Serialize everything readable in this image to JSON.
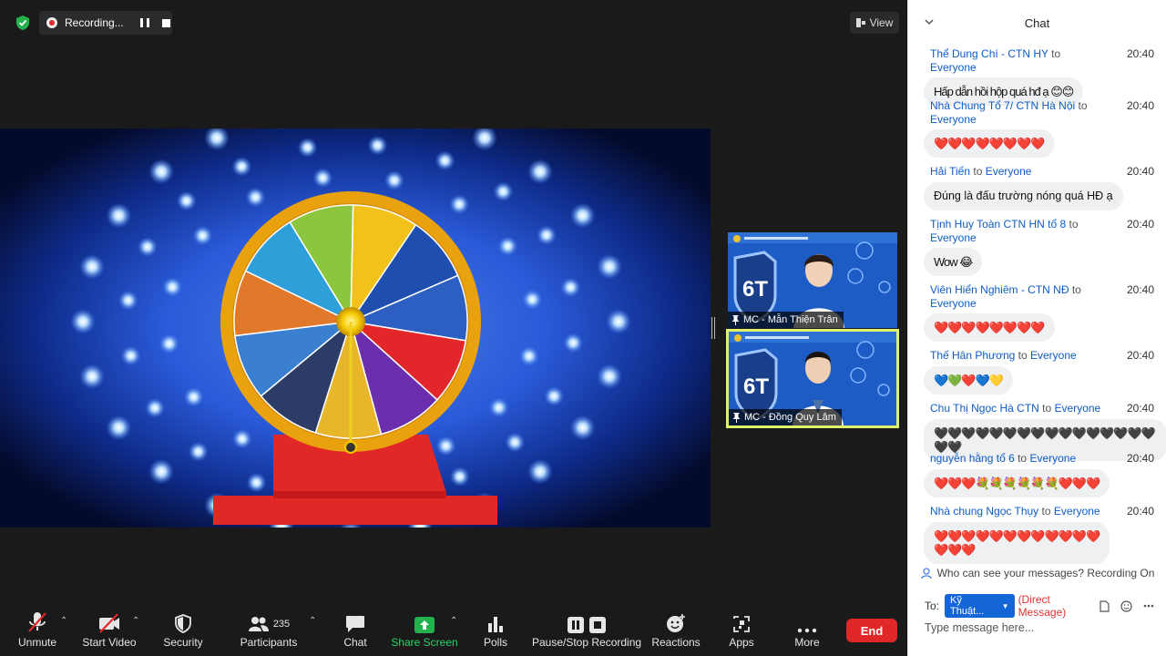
{
  "recording": {
    "label": "Recording..."
  },
  "view_button": {
    "label": "View"
  },
  "participants_tiles": [
    {
      "name": "MC - Mẫn Thiện Trân"
    },
    {
      "name": "MC - Đồng Quy Lâm"
    }
  ],
  "toolbar": {
    "unmute": "Unmute",
    "start_video": "Start Video",
    "security": "Security",
    "participants": "Participants",
    "participants_count": "235",
    "chat": "Chat",
    "share_screen": "Share Screen",
    "polls": "Polls",
    "pause_stop_recording": "Pause/Stop Recording",
    "reactions": "Reactions",
    "apps": "Apps",
    "more": "More",
    "end": "End"
  },
  "chat": {
    "title": "Chat",
    "messages": [
      {
        "sender": "Thể Dung Chí - CTN HY",
        "to_word": "to",
        "recipient": "Everyone",
        "time": "20:40",
        "text": "Hấp dẫn hồi hộp quá hđ ạ 😊😊"
      },
      {
        "sender": "Nhà Chung Tổ 7/ CTN Hà Nội",
        "to_word": "to",
        "recipient": "Everyone",
        "time": "20:40",
        "text": "❤️❤️❤️❤️❤️❤️❤️❤️"
      },
      {
        "sender": "Hải Tiến",
        "to_word": "to",
        "recipient": "Everyone",
        "time": "20:40",
        "text": "Đúng là đấu trường nóng quá HĐ ạ"
      },
      {
        "sender": "Tịnh Huy Toàn CTN HN tổ 8",
        "to_word": "to",
        "recipient": "Everyone",
        "time": "20:40",
        "text": "Wow 😂"
      },
      {
        "sender": "Viên Hiển Nghiêm - CTN NĐ",
        "to_word": "to",
        "recipient": "Everyone",
        "time": "20:40",
        "text": "❤️❤️❤️❤️❤️❤️❤️❤️"
      },
      {
        "sender": "Thế Hân Phương",
        "to_word": "to",
        "recipient": "Everyone",
        "time": "20:40",
        "text": "💙💚❤️💙💛"
      },
      {
        "sender": "Chu Thị Ngọc Hà CTN",
        "to_word": "to",
        "recipient": "Everyone",
        "time": "20:40",
        "text": "🖤🖤🖤🖤🖤🖤🖤🖤🖤🖤🖤🖤🖤🖤🖤🖤🖤🖤"
      },
      {
        "sender": "nguyễn hằng tổ 6",
        "to_word": "to",
        "recipient": "Everyone",
        "time": "20:40",
        "text": "❤️❤️❤️💐💐💐💐💐💐❤️❤️❤️"
      },
      {
        "sender": "Nhà chung Ngọc Thụy",
        "to_word": "to",
        "recipient": "Everyone",
        "time": "20:40",
        "text": "❤️❤️❤️❤️❤️❤️❤️❤️❤️❤️❤️❤️\n❤️❤️❤️"
      }
    ],
    "privacy_note": "Who can see your messages? Recording On",
    "to_label": "To:",
    "recipient_selected": "Kỹ Thuật...",
    "direct_message": "(Direct Message)",
    "input_placeholder": "Type message here..."
  }
}
